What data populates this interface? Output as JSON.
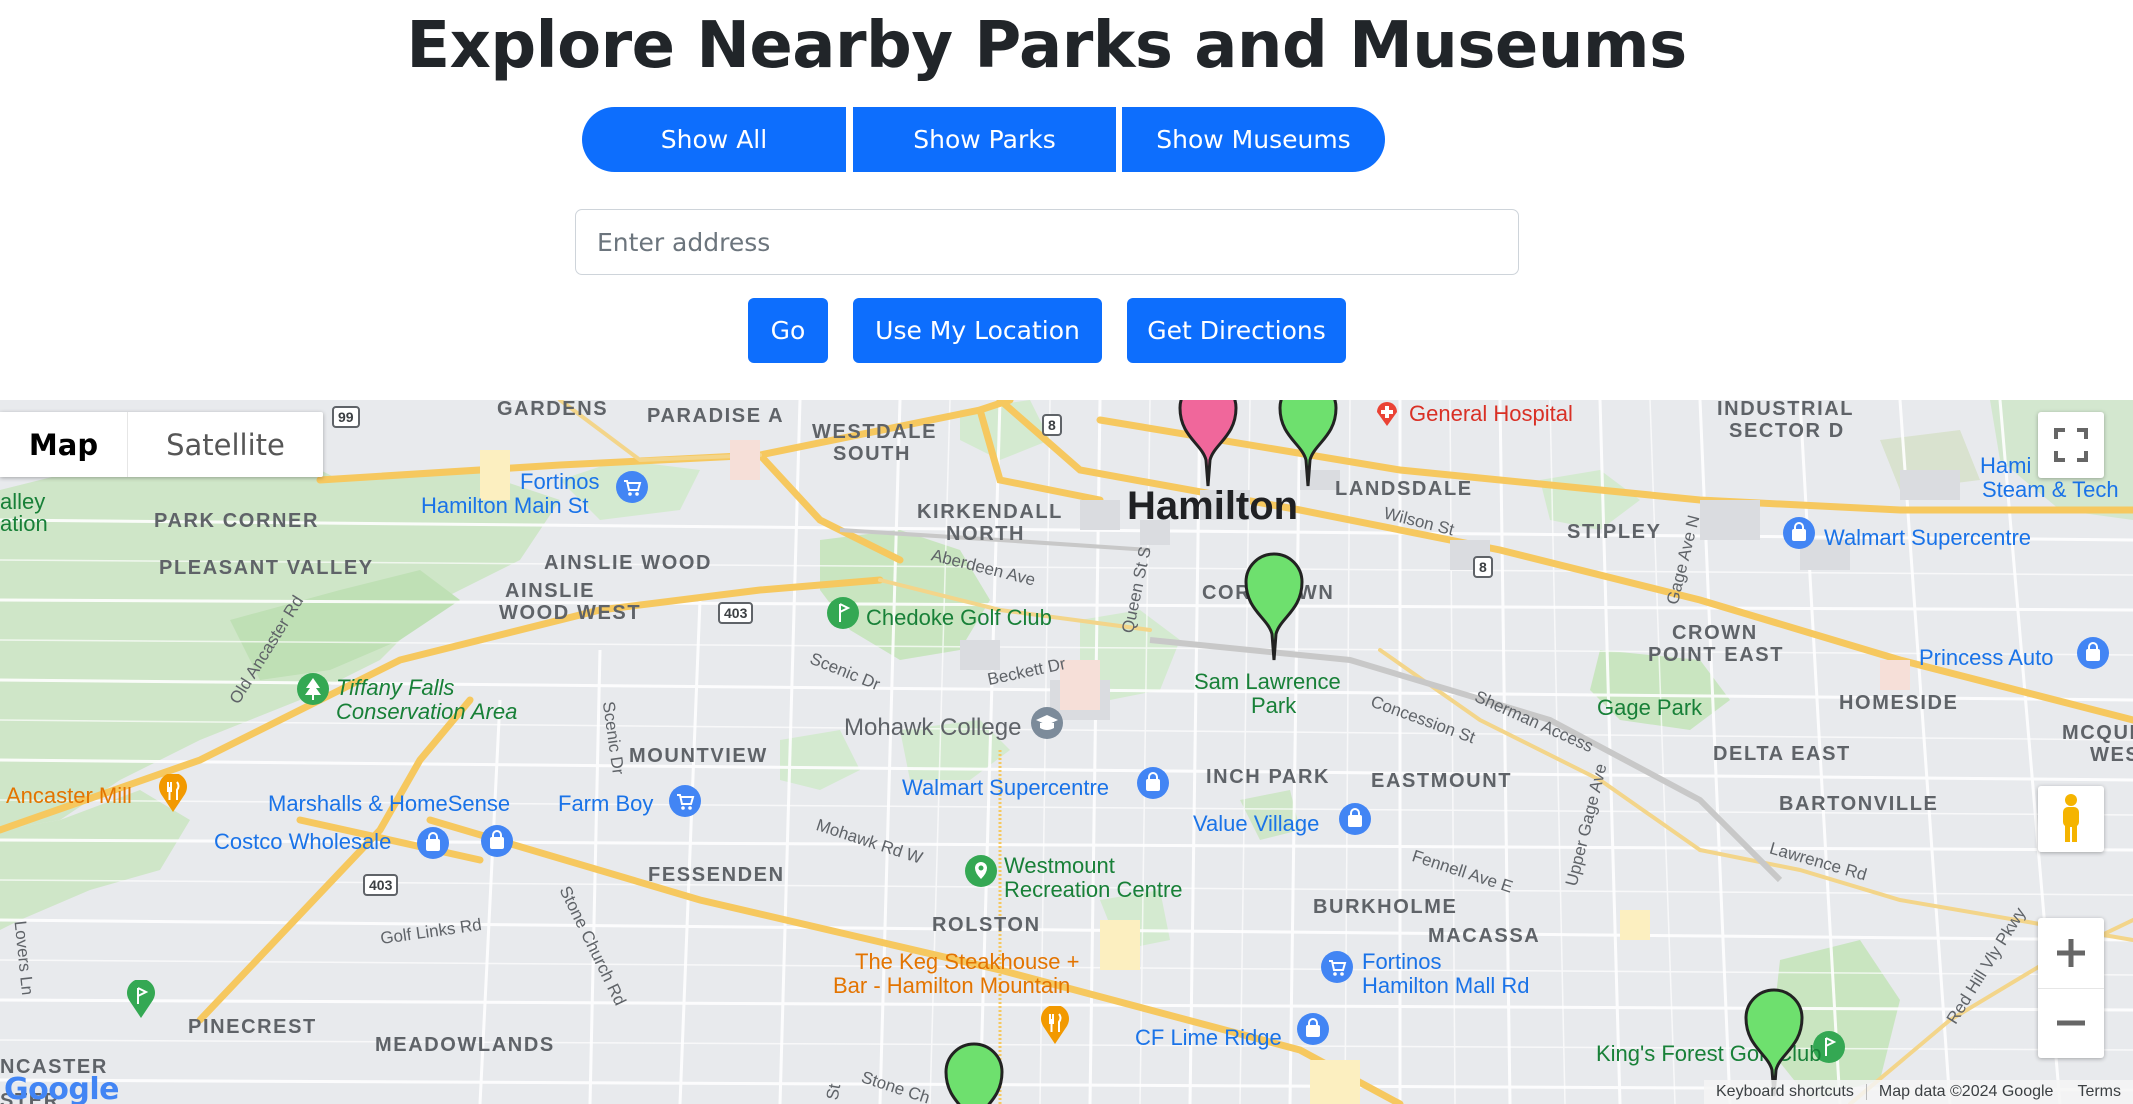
{
  "page": {
    "title": "Explore Nearby Parks and Museums",
    "filters": {
      "all": "Show All",
      "parks": "Show Parks",
      "museums": "Show Museums"
    },
    "address_placeholder": "Enter address",
    "address_value": "",
    "actions": {
      "go": "Go",
      "location": "Use My Location",
      "directions": "Get Directions"
    }
  },
  "map": {
    "type_control": {
      "map": "Map",
      "satellite": "Satellite"
    },
    "city": "Hamilton",
    "neighbourhoods": {
      "gardens": "GARDENS",
      "paradise": "PARADISE A",
      "westdale1": "WESTDALE",
      "westdale2": "SOUTH",
      "industrial1": "INDUSTRIAL",
      "industrial2": "SECTOR D",
      "kirkendall1": "KIRKENDALL",
      "kirkendall2": "NORTH",
      "landsdale": "LANDSDALE",
      "stipley": "STIPLEY",
      "pleasant": "PLEASANT VALLEY",
      "ainslie": "AINSLIE WOOD",
      "ainsliew1": "AINSLIE",
      "ainsliew2": "WOOD WEST",
      "corktown": "CORKTOWN",
      "crown1": "CROWN",
      "crown2": "POINT EAST",
      "homeside": "HOMESIDE",
      "mcque": "MCQUE",
      "mcque2": "WES",
      "delta": "DELTA EAST",
      "mountview": "MOUNTVIEW",
      "inch": "INCH PARK",
      "eastmount": "EASTMOUNT",
      "bartonville": "BARTONVILLE",
      "fessenden": "FESSENDEN",
      "rolston": "ROLSTON",
      "burkholme": "BURKHOLME",
      "macassa": "MACASSA",
      "pinecrest": "PINECREST",
      "meadowlands": "MEADOWLANDS",
      "parkcorner": "PARK CORNER",
      "ancaster": "NCASTER",
      "ncaster2": "STER",
      "lalleyleft": "alley",
      "ationleft": "ation"
    },
    "streets": {
      "aberdeen": "Aberdeen Ave",
      "queen": "Queen St S",
      "beckett": "Beckett Dr",
      "scenic": "Scenic Dr",
      "scenicdr": "Scenic Dr",
      "oldancaster": "Old Ancaster Rd",
      "wilson": "Wilson St",
      "gage": "Gage Ave N",
      "concession": "Concession St",
      "sherman": "Sherman Access",
      "mohawk": "Mohawk Rd W",
      "uppergage": "Upper Gage Ave",
      "fennell": "Fennell Ave E",
      "lawrence": "Lawrence Rd",
      "golflinks": "Golf Links Rd",
      "stonechurch": "Stone Church Rd",
      "loversln": "Lovers Ln",
      "redhill": "Red Hill Vly Pkwy",
      "stonech2": "Stone Ch",
      "st": "St"
    },
    "shields": {
      "s99": "99",
      "s8a": "8",
      "s8b": "8",
      "s403a": "403",
      "s403b": "403"
    },
    "pois": {
      "general_hospital": "General Hospital",
      "fortinos_main1": "Fortinos",
      "fortinos_main2": "Hamilton Main St",
      "hamilton_steam1": "Hami",
      "hamilton_steam2": "Steam & Tech",
      "walmart_east": "Walmart Supercentre",
      "chedoke": "Chedoke Golf Club",
      "tiffany1": "Tiffany Falls",
      "tiffany2": "Conservation Area",
      "sam1": "Sam Lawrence",
      "sam2": "Park",
      "princess": "Princess Auto",
      "gage_park": "Gage Park",
      "mohawk_college": "Mohawk College",
      "walmart_mid": "Walmart Supercentre",
      "ancaster_mill": "Ancaster Mill",
      "marshalls": "Marshalls & HomeSense",
      "farmboy": "Farm Boy",
      "value_village": "Value Village",
      "costco": "Costco Wholesale",
      "westmount1": "Westmount",
      "westmount2": "Recreation Centre",
      "keg1": "The Keg Steakhouse +",
      "keg2": "Bar - Hamilton Mountain",
      "fortinos_mall1": "Fortinos",
      "fortinos_mall2": "Hamilton Mall Rd",
      "cf_lime": "CF Lime Ridge",
      "kings_forest": "King's Forest Golf Club"
    },
    "footer": {
      "shortcuts": "Keyboard shortcuts",
      "data": "Map data ©2024 Google",
      "terms": "Terms"
    },
    "logo": "Google",
    "colors": {
      "park_marker": "#6ee06e",
      "museum_marker": "#f0679b",
      "button": "#0d6efd"
    }
  }
}
